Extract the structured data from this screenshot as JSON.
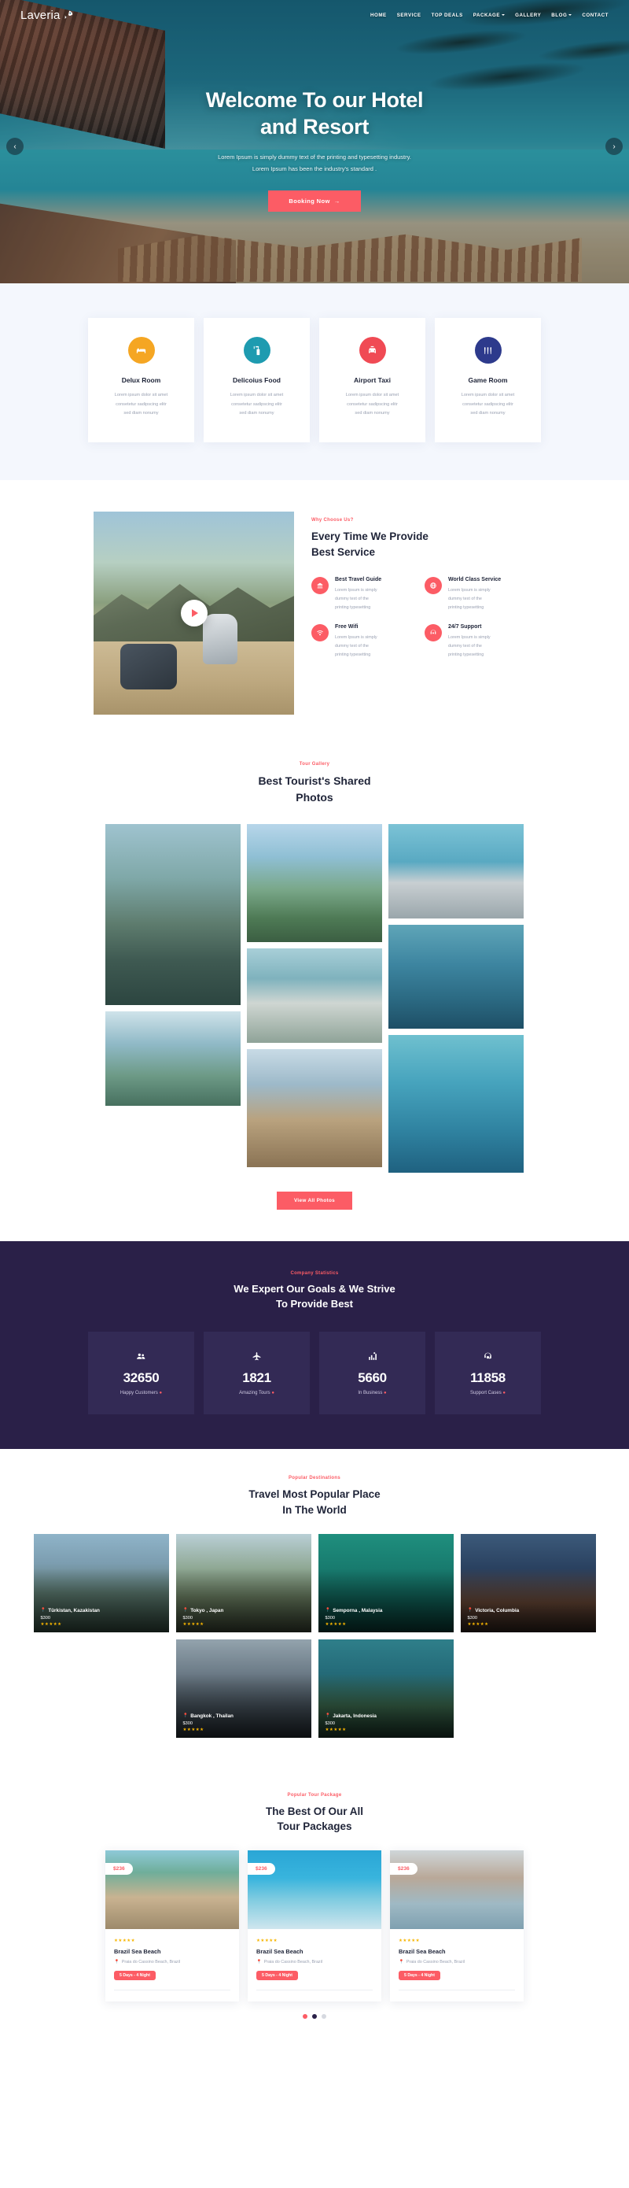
{
  "brand": {
    "name": "Laveria",
    "icon": "rocket-icon"
  },
  "nav": {
    "items": [
      {
        "label": "HOME",
        "dropdown": false
      },
      {
        "label": "SERVICE",
        "dropdown": false
      },
      {
        "label": "TOP DEALS",
        "dropdown": false
      },
      {
        "label": "PACKAGE",
        "dropdown": true
      },
      {
        "label": "GALLERY",
        "dropdown": false
      },
      {
        "label": "BLOG",
        "dropdown": true
      },
      {
        "label": "CONTACT",
        "dropdown": false
      }
    ]
  },
  "hero": {
    "title_line1": "Welcome To our Hotel",
    "title_line2": "and Resort",
    "sub_line1": "Lorem Ipsum is simply dummy text of the printing and typesetting industry.",
    "sub_line2": "Lorem Ipsum has been the industry's standard .",
    "cta": "Booking Now",
    "cta_arrow": "→",
    "prev_arrow": "‹",
    "next_arrow": "›"
  },
  "features": [
    {
      "title": "Delux Room",
      "desc_l1": "Lorem ipsum dolor sit amet",
      "desc_l2": "consetetur sadipscing elitr",
      "desc_l3": "sed diam nonumy",
      "color": "#f5a623",
      "icon": "bed-icon"
    },
    {
      "title": "Delicoius Food",
      "desc_l1": "Lorem ipsum dolor sit amet",
      "desc_l2": "consetetur sadipscing elitr",
      "desc_l3": "sed diam nonumy",
      "color": "#1e9bb0",
      "icon": "food-icon"
    },
    {
      "title": "Airport Taxi",
      "desc_l1": "Lorem ipsum dolor sit amet",
      "desc_l2": "consetetur sadipscing elitr",
      "desc_l3": "sed diam nonumy",
      "color": "#f04a54",
      "icon": "taxi-icon"
    },
    {
      "title": "Game Room",
      "desc_l1": "Lorem ipsum dolor sit amet",
      "desc_l2": "consetetur sadipscing elitr",
      "desc_l3": "sed diam nonumy",
      "color": "#2d3a8c",
      "icon": "bowling-icon"
    }
  ],
  "why": {
    "eyebrow": "Why Choose Us?",
    "title_l1": "Every Time We Provide",
    "title_l2": "Best Service",
    "play": "play-icon",
    "items": [
      {
        "title": "Best Travel Guide",
        "l1": "Lorem Ipsum is simply",
        "l2": "dummy text of the",
        "l3": "printing typesetting",
        "icon": "guide-icon"
      },
      {
        "title": "World Class Service",
        "l1": "Lorem Ipsum is simply",
        "l2": "dummy text of the",
        "l3": "printing typesetting",
        "icon": "globe-icon"
      },
      {
        "title": "Free Wifi",
        "l1": "Lorem Ipsum is simply",
        "l2": "dummy text of the",
        "l3": "printing typesetting",
        "icon": "wifi-icon"
      },
      {
        "title": "24/7 Support",
        "l1": "Lorem Ipsum is simply",
        "l2": "dummy text of the",
        "l3": "printing typesetting",
        "icon": "support-icon"
      }
    ]
  },
  "gallery": {
    "eyebrow": "Tour Gallery",
    "title_l1": "Best Tourist's Shared",
    "title_l2": "Photos",
    "view_all": "View All Photos"
  },
  "stats": {
    "eyebrow": "Company Statistics",
    "title_l1": "We Expert Our Goals & We Strive",
    "title_l2": "To Provide Best",
    "items": [
      {
        "value": "32650",
        "label": "Happy Customers",
        "icon": "users-icon"
      },
      {
        "value": "1821",
        "label": "Amazing Tours",
        "icon": "plane-icon"
      },
      {
        "value": "5660",
        "label": "In Business",
        "icon": "chart-icon"
      },
      {
        "value": "11858",
        "label": "Support Cases",
        "icon": "headset-icon"
      }
    ]
  },
  "destinations": {
    "eyebrow": "Popular Destinations",
    "title_l1": "Travel Most Popular Place",
    "title_l2": "In The World",
    "cards": [
      {
        "location": "Türkistan, Kazakistan",
        "price": "$300",
        "stars": "★★★★★"
      },
      {
        "location": "Tokyo , Japan",
        "price": "$300",
        "stars": "★★★★★"
      },
      {
        "location": "Semporna , Malaysia",
        "price": "$300",
        "stars": "★★★★★"
      },
      {
        "location": "Victoria, Columbia",
        "price": "$300",
        "stars": "★★★★★"
      },
      {
        "location": "Bangkok , Thailan",
        "price": "$300",
        "stars": "★★★★★"
      },
      {
        "location": "Jakarta, Indonesia",
        "price": "$300",
        "stars": "★★★★★"
      }
    ]
  },
  "packages": {
    "eyebrow": "Popular Tour Package",
    "title_l1": "The Best Of Our All",
    "title_l2": "Tour Packages",
    "cards": [
      {
        "price": "$236",
        "stars": "★★★★★",
        "title": "Brazil Sea Beach",
        "location": "Praia do Cassino Beach, Brazil",
        "duration": "5 Days - 4 Night"
      },
      {
        "price": "$236",
        "stars": "★★★★★",
        "title": "Brazil Sea Beach",
        "location": "Praia do Cassino Beach, Brazil",
        "duration": "5 Days - 4 Night"
      },
      {
        "price": "$236",
        "stars": "★★★★★",
        "title": "Brazil Sea Beach",
        "location": "Praia do Cassino Beach, Brazil",
        "duration": "5 Days - 4 Night"
      }
    ]
  },
  "colors": {
    "accent": "#fc5c65",
    "dark": "#2a2048",
    "star": "#f7b500"
  }
}
